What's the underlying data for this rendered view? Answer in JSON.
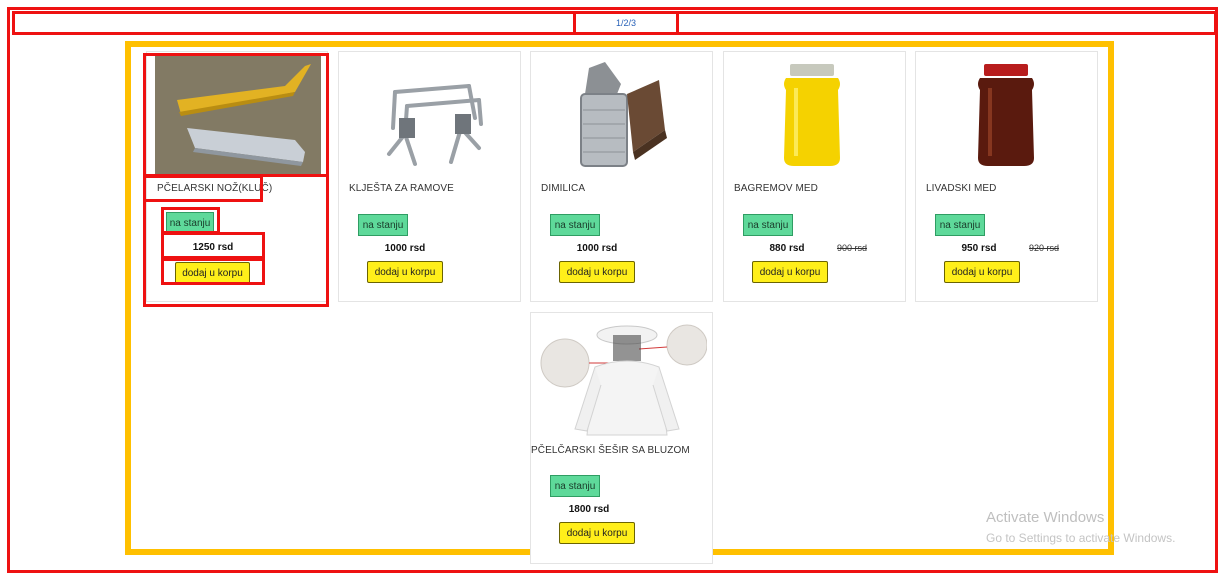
{
  "pagination": {
    "label": "1/2/3"
  },
  "products": [
    {
      "name": "PČELARSKI NOŽ(KLUČ)",
      "stock": "na stanju",
      "price": "1250 rsd",
      "old_price": "",
      "button": "dodaj u korpu",
      "image": "hive-tool-image"
    },
    {
      "name": "KLJEŠTA ZA RAMOVE",
      "stock": "na stanju",
      "price": "1000 rsd",
      "old_price": "",
      "button": "dodaj u korpu",
      "image": "frame-grip-image"
    },
    {
      "name": "DIMILICA",
      "stock": "na stanju",
      "price": "1000 rsd",
      "old_price": "",
      "button": "dodaj u korpu",
      "image": "bee-smoker-image"
    },
    {
      "name": "BAGREMOV MED",
      "stock": "na stanju",
      "price": "880 rsd",
      "old_price": "900 rsd",
      "button": "dodaj u korpu",
      "image": "acacia-honey-jar-image"
    },
    {
      "name": "LIVADSKI MED",
      "stock": "na stanju",
      "price": "950 rsd",
      "old_price": "920 rsd",
      "button": "dodaj u korpu",
      "image": "meadow-honey-jar-image"
    },
    {
      "name": "PČELČARSKI ŠEŠIR SA BLUZOM",
      "stock": "na stanju",
      "price": "1800 rsd",
      "old_price": "",
      "button": "dodaj u korpu",
      "image": "beekeeper-suit-image"
    }
  ],
  "watermark": {
    "line1": "Activate Windows",
    "line2": "Go to Settings to activate Windows."
  },
  "colors": {
    "annotation_red": "#ee1111",
    "annotation_orange": "#ffc000",
    "stock_badge": "#5ed99a",
    "add_button": "#ffef1a",
    "pager_link": "#2a63b8"
  }
}
